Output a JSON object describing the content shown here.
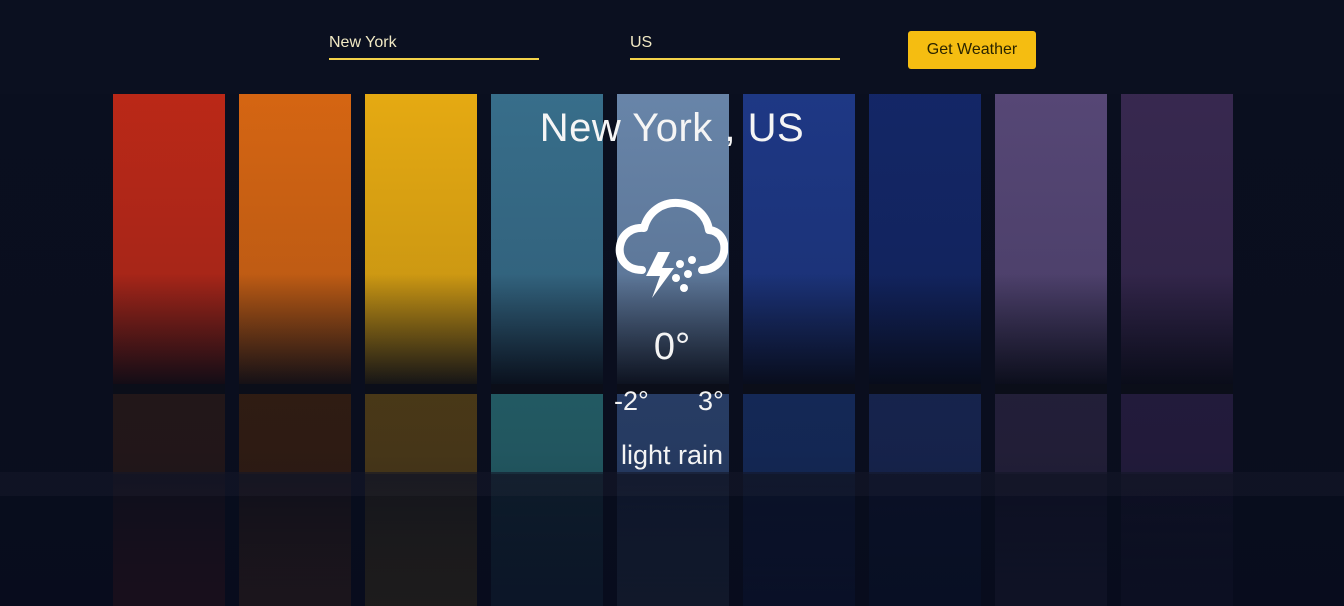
{
  "form": {
    "city_value": "New York",
    "country_value": "US",
    "submit_label": "Get Weather"
  },
  "weather": {
    "location": "New York , US",
    "temp": "0°",
    "temp_min": "-2°",
    "temp_max": "3°",
    "description": "light rain",
    "icon": "thunderstorm-rain-icon"
  },
  "strips": [
    {
      "sky": "#c42a17",
      "sea": "#2a1a18"
    },
    {
      "sky": "#e06a12",
      "sea": "#3a2010"
    },
    {
      "sky": "#f1b211",
      "sea": "#5b4416"
    },
    {
      "sky": "#3a7390",
      "sea": "#2a6f76"
    },
    {
      "sky": "#6d8bb0",
      "sea": "#304a78"
    },
    {
      "sky": "#1f3a8a",
      "sea": "#173066"
    },
    {
      "sky": "#14286a",
      "sea": "#1a2a5a"
    },
    {
      "sky": "#5a4a7a",
      "sea": "#2a2440"
    },
    {
      "sky": "#3a2a52",
      "sea": "#2a1f44"
    }
  ]
}
